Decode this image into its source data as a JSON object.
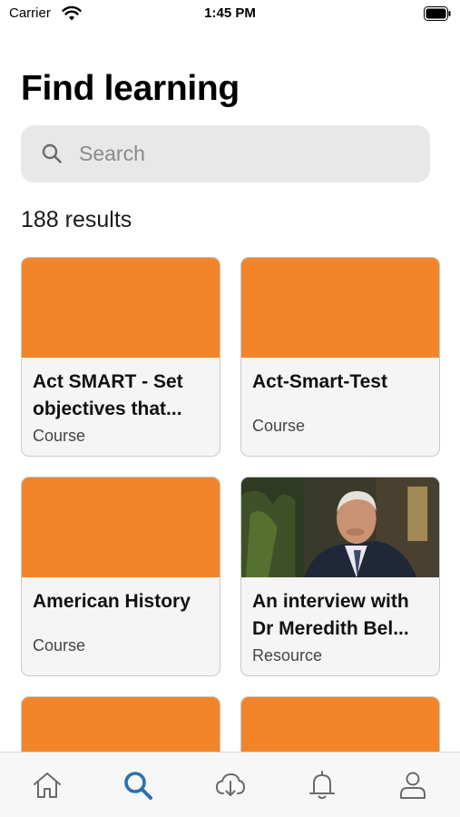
{
  "status_bar": {
    "carrier": "Carrier",
    "time": "1:45 PM"
  },
  "header": {
    "title": "Find learning"
  },
  "search": {
    "placeholder": "Search",
    "value": ""
  },
  "results": {
    "count_text": "188 results"
  },
  "cards": [
    {
      "title": "Act SMART - Set objectives that...",
      "type": "Course",
      "image": "orange-placeholder"
    },
    {
      "title": "Act-Smart-Test",
      "type": "Course",
      "image": "orange-placeholder"
    },
    {
      "title": "American History",
      "type": "Course",
      "image": "orange-placeholder"
    },
    {
      "title": "An interview with Dr Meredith Bel...",
      "type": "Resource",
      "image": "photo-elderly-man-in-suit"
    },
    {
      "title": "",
      "type": "",
      "image": "orange-placeholder"
    },
    {
      "title": "",
      "type": "",
      "image": "orange-placeholder"
    }
  ],
  "tab_bar": {
    "tabs": [
      {
        "icon": "home-icon"
      },
      {
        "icon": "search-icon",
        "active": true
      },
      {
        "icon": "cloud-download-icon"
      },
      {
        "icon": "bell-icon"
      },
      {
        "icon": "profile-icon"
      }
    ]
  },
  "colors": {
    "accent": "#f28529",
    "active_tab": "#2e6fad",
    "inactive_tab": "#6a6a6a",
    "search_bg": "#e8e8e8"
  }
}
